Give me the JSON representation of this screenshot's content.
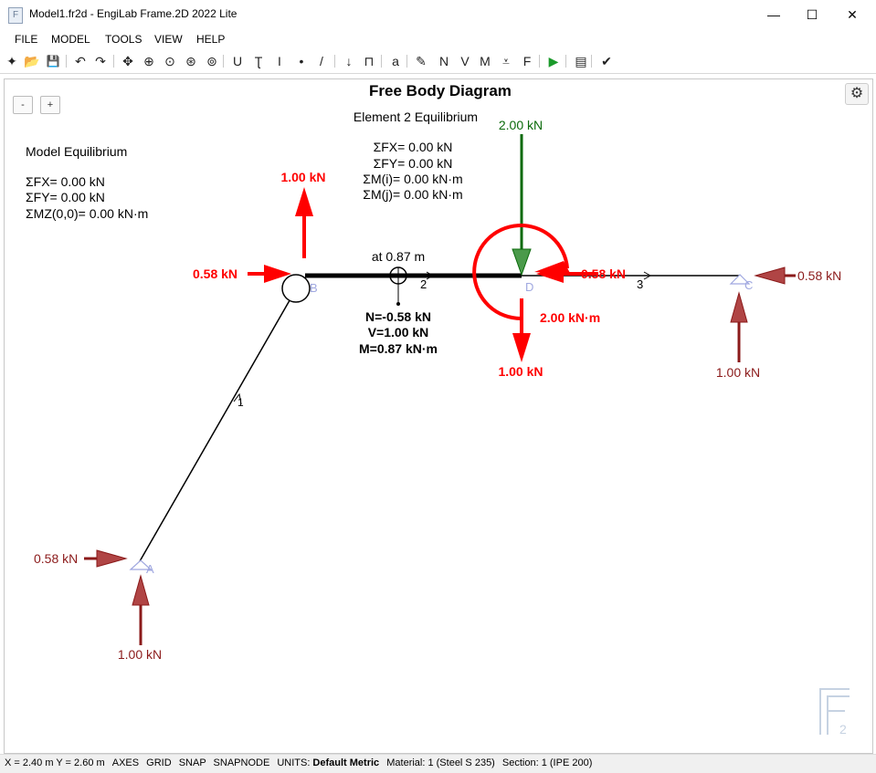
{
  "window": {
    "title": "Model1.fr2d - EngiLab Frame.2D 2022 Lite",
    "icon_text": "F",
    "minimize": "—",
    "maximize": "☐",
    "close": "✕"
  },
  "menu": [
    "FILE",
    "MODEL",
    "TOOLS",
    "VIEW",
    "HELP"
  ],
  "toolbar": [
    {
      "name": "new-file-icon",
      "glyph": "✦"
    },
    {
      "name": "open-folder-icon",
      "glyph": "📂"
    },
    {
      "name": "save-icon",
      "glyph": "💾"
    },
    {
      "name": "undo-icon",
      "glyph": "↶"
    },
    {
      "name": "redo-icon",
      "glyph": "↷"
    },
    {
      "name": "pan-icon",
      "glyph": "✥"
    },
    {
      "name": "zoom-in-icon",
      "glyph": "⊕"
    },
    {
      "name": "zoom-extents-icon",
      "glyph": "⊙"
    },
    {
      "name": "zoom-window-icon",
      "glyph": "⊛"
    },
    {
      "name": "zoom-previous-icon",
      "glyph": "⊚"
    },
    {
      "name": "support-icon",
      "glyph": "U"
    },
    {
      "name": "section-icon",
      "glyph": "Ʈ"
    },
    {
      "name": "material-icon",
      "glyph": "I"
    },
    {
      "name": "node-icon",
      "glyph": "•"
    },
    {
      "name": "element-icon",
      "glyph": "/"
    },
    {
      "name": "nodal-load-icon",
      "glyph": "↓"
    },
    {
      "name": "element-load-icon",
      "glyph": "⊓"
    },
    {
      "name": "dimension-icon",
      "glyph": "a"
    },
    {
      "name": "edit-pencil-icon",
      "glyph": "✎"
    },
    {
      "name": "axial-force-icon",
      "glyph": "N"
    },
    {
      "name": "shear-force-icon",
      "glyph": "V"
    },
    {
      "name": "moment-icon",
      "glyph": "M"
    },
    {
      "name": "reactions-icon",
      "glyph": "⩡"
    },
    {
      "name": "free-body-icon",
      "glyph": "F"
    },
    {
      "name": "run-analysis-icon",
      "glyph": "▶"
    },
    {
      "name": "report-icon",
      "glyph": "▤"
    },
    {
      "name": "check-icon",
      "glyph": "✔"
    }
  ],
  "diagram": {
    "title": "Free Body Diagram",
    "element_title": "Element 2 Equilibrium",
    "element_eq": [
      "ΣFX= 0.00 kN",
      "ΣFY= 0.00 kN",
      "ΣM(i)= 0.00 kN·m",
      "ΣM(j)= 0.00 kN·m"
    ],
    "model_title": "Model Equilibrium",
    "model_eq": [
      "ΣFX= 0.00 kN",
      "ΣFY= 0.00 kN",
      "ΣMZ(0,0)= 0.00 kN·m"
    ],
    "zoom_out": "-",
    "zoom_in": "+",
    "gear": "⚙",
    "node_labels": {
      "A": "A",
      "B": "B",
      "C": "C",
      "D": "D"
    },
    "element_labels": {
      "e1": "1",
      "e2": "2",
      "e3": "3"
    },
    "probe": {
      "position": "at 0.87 m",
      "N": "N=-0.58 kN",
      "V": "V=1.00 kN",
      "M": "M=0.87 kN·m"
    },
    "forces": {
      "b_vertical": "1.00 kN",
      "b_horizontal": "0.58 kN",
      "d_applied": "2.00 kN",
      "d_horizontal": "0.58 kN",
      "d_moment": "2.00 kN·m",
      "d_vertical": "1.00 kN",
      "c_horizontal": "0.58 kN",
      "c_vertical": "1.00 kN",
      "a_horizontal": "0.58 kN",
      "a_vertical": "1.00 kN"
    },
    "watermark_main": "F",
    "watermark_sub": "2"
  },
  "colors": {
    "reaction": "#8b1a1a",
    "internal": "#ff0000",
    "applied": "#0a6a0a",
    "node_label": "#a0a8e0"
  },
  "status": {
    "coords": "X = 2.40 m  Y = 2.60 m",
    "axes": "AXES",
    "grid": "GRID",
    "snap": "SNAP",
    "snapnode": "SNAPNODE",
    "units_label": "UNITS:",
    "units_value": "Default Metric",
    "material": "Material: 1 (Steel S 235)",
    "section": "Section: 1 (IPE 200)"
  }
}
